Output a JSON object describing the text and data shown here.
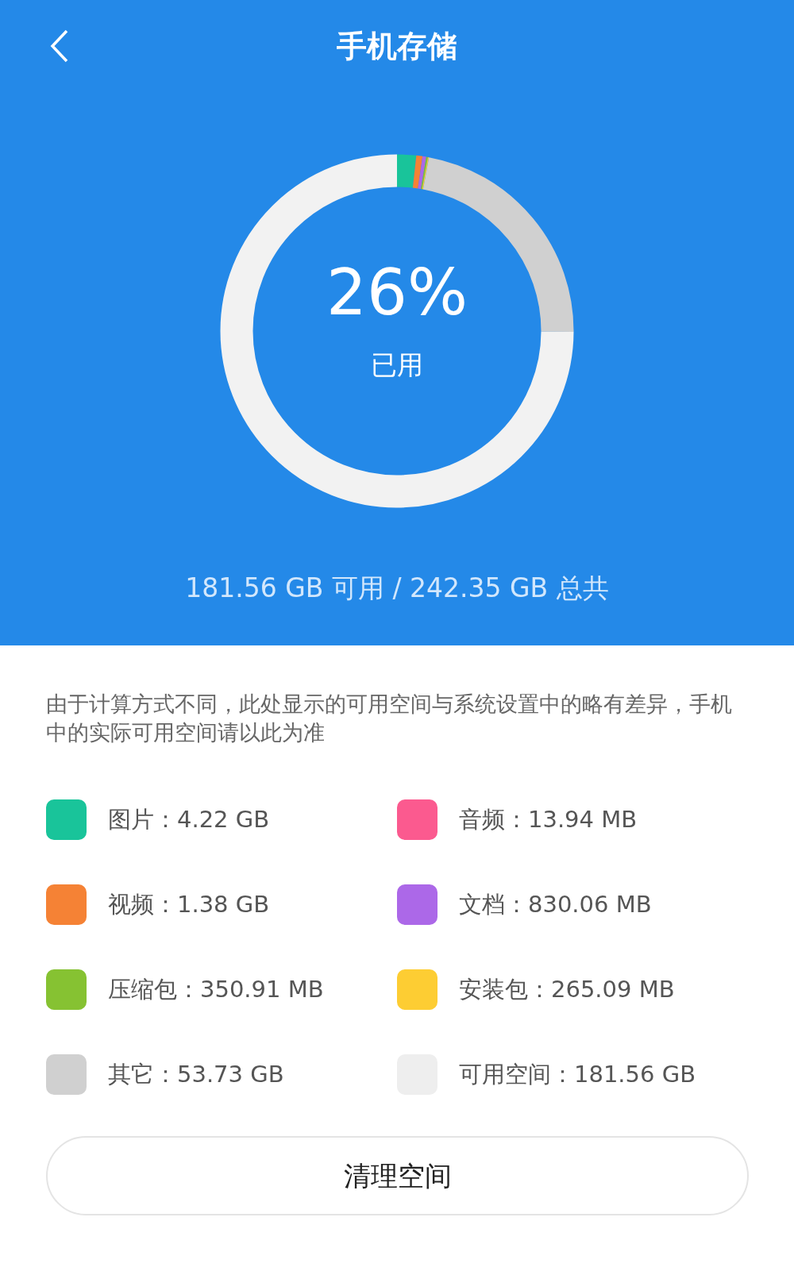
{
  "header": {
    "title": "手机存储"
  },
  "usage": {
    "percent": "26%",
    "label": "已用",
    "summary": "181.56 GB 可用 / 242.35 GB 总共"
  },
  "note": "由于计算方式不同，此处显示的可用空间与系统设置中的略有差异，手机中的实际可用空间请以此为准",
  "legend": [
    {
      "label": "图片：4.22 GB",
      "color": "#19c49a"
    },
    {
      "label": "音频：13.94 MB",
      "color": "#fb5a8f"
    },
    {
      "label": "视频：1.38 GB",
      "color": "#f58235"
    },
    {
      "label": "文档：830.06 MB",
      "color": "#ac68e8"
    },
    {
      "label": "压缩包：350.91 MB",
      "color": "#86c232"
    },
    {
      "label": "安装包：265.09 MB",
      "color": "#fdcd33"
    },
    {
      "label": "其它：53.73 GB",
      "color": "#d0d0d0"
    },
    {
      "label": "可用空间：181.56 GB",
      "color": "#eeeeee"
    }
  ],
  "button": "清理空间"
}
